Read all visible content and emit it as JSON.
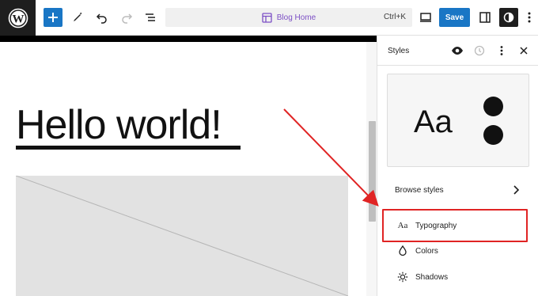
{
  "toolbar": {
    "wp_logo_icon": "wordpress-logo",
    "add_icon": "plus-icon",
    "tools_icon": "pencil-icon",
    "undo_icon": "undo-icon",
    "redo_icon": "redo-icon",
    "list_view_icon": "list-view-icon",
    "command_label": "Blog Home",
    "command_shortcut": "Ctrl+K",
    "view_icon": "desktop-icon",
    "save_label": "Save",
    "settings_icon": "sidebar-icon",
    "styles_icon": "half-circle-icon",
    "more_icon": "vertical-ellipsis-icon"
  },
  "canvas": {
    "post_title": "Hello world!"
  },
  "sidebar": {
    "title": "Styles",
    "header_icons": [
      "eye-icon",
      "revisions-icon",
      "vertical-ellipsis-icon",
      "close-icon"
    ],
    "preview_text": "Aa",
    "browse_styles_label": "Browse styles",
    "items": [
      {
        "label": "Typography",
        "icon": "Aa"
      },
      {
        "label": "Colors",
        "icon": "droplet-icon"
      },
      {
        "label": "Shadows",
        "icon": "sun-icon"
      }
    ]
  },
  "colors": {
    "accent": "#1976c5",
    "command_text": "#7c4fc5",
    "highlight": "#e02424"
  }
}
